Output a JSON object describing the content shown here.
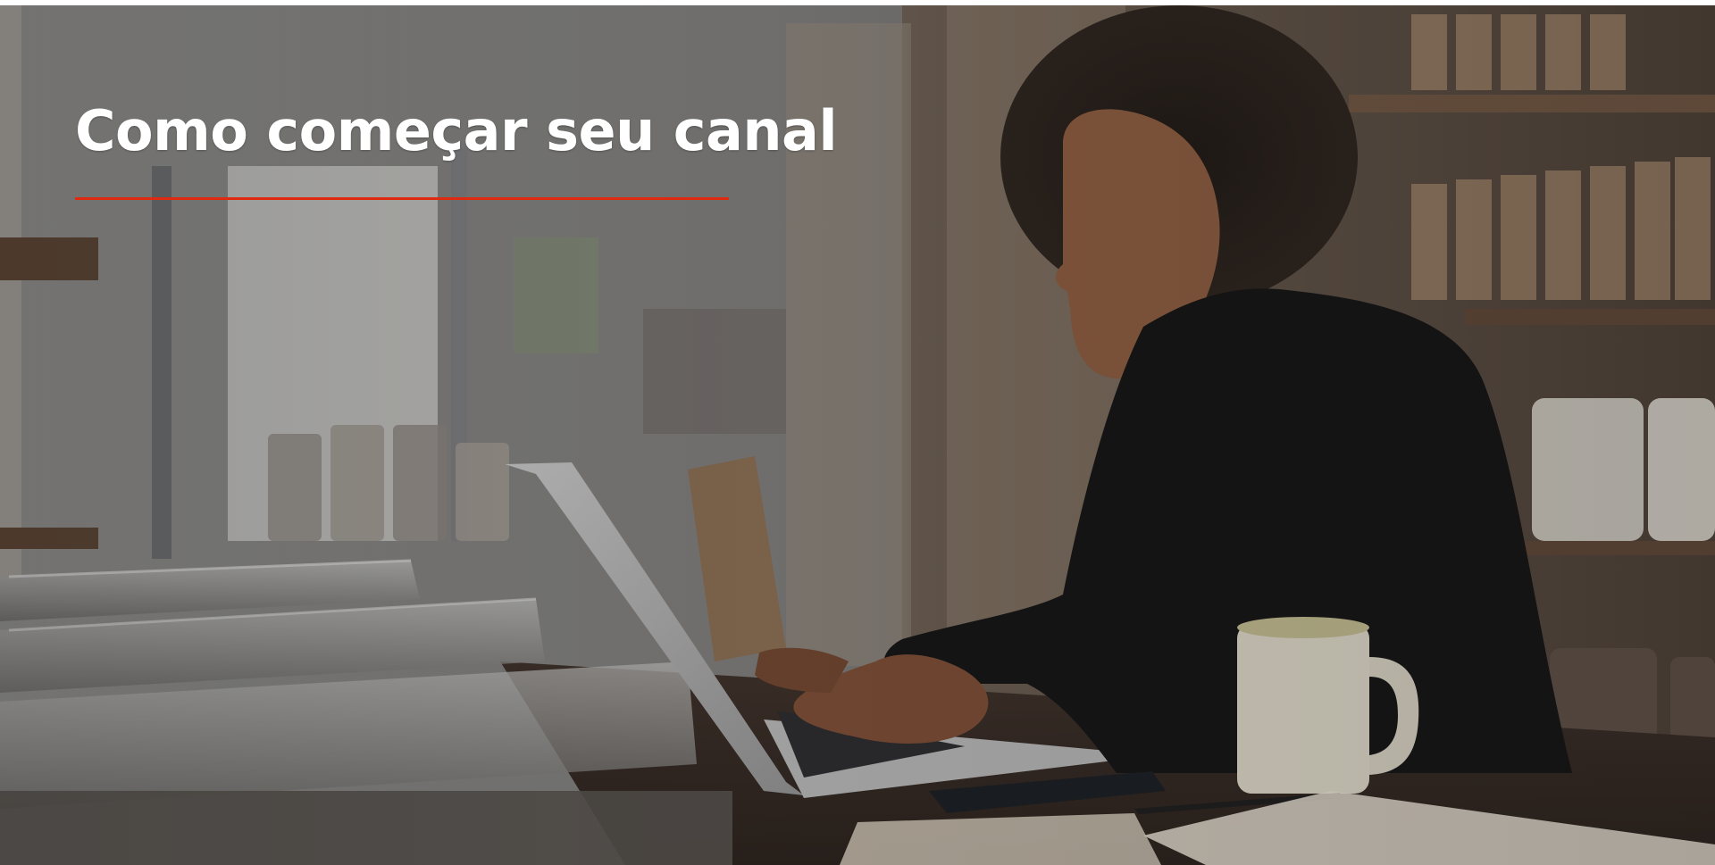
{
  "hero": {
    "title": "Como começar seu canal",
    "accent_color": "#e02a0f",
    "background": "photo-woman-typing-on-laptop-in-shop"
  }
}
